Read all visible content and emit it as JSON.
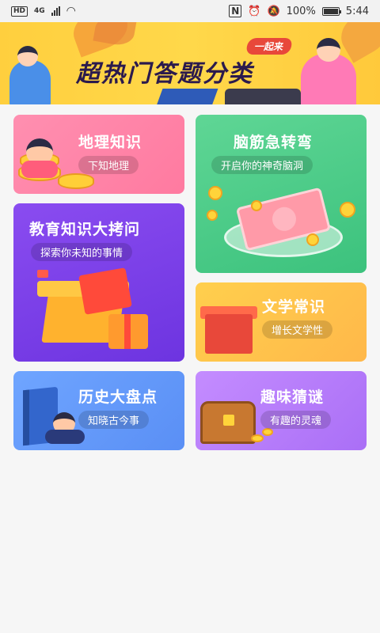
{
  "status_bar": {
    "network_badge": "HD",
    "network_type": "4G",
    "battery": "100%",
    "time": "5:44"
  },
  "banner": {
    "tag": "一起来",
    "title": "超热门答题分类"
  },
  "categories": [
    {
      "title": "地理知识",
      "subtitle": "下知地理"
    },
    {
      "title": "脑筋急转弯",
      "subtitle": "开启你的神奇脑洞"
    },
    {
      "title": "教育知识大拷问",
      "subtitle": "探索你未知的事情"
    },
    {
      "title": "文学常识",
      "subtitle": "增长文学性"
    },
    {
      "title": "历史大盘点",
      "subtitle": "知晓古今事"
    },
    {
      "title": "趣味猜谜",
      "subtitle": "有趣的灵魂"
    }
  ],
  "colors": {
    "geo": "#ff8fb0",
    "brain": "#4fce89",
    "edu": "#7a3fe8",
    "lit": "#ffc34b",
    "his": "#6399fa",
    "fun": "#b67df9"
  }
}
